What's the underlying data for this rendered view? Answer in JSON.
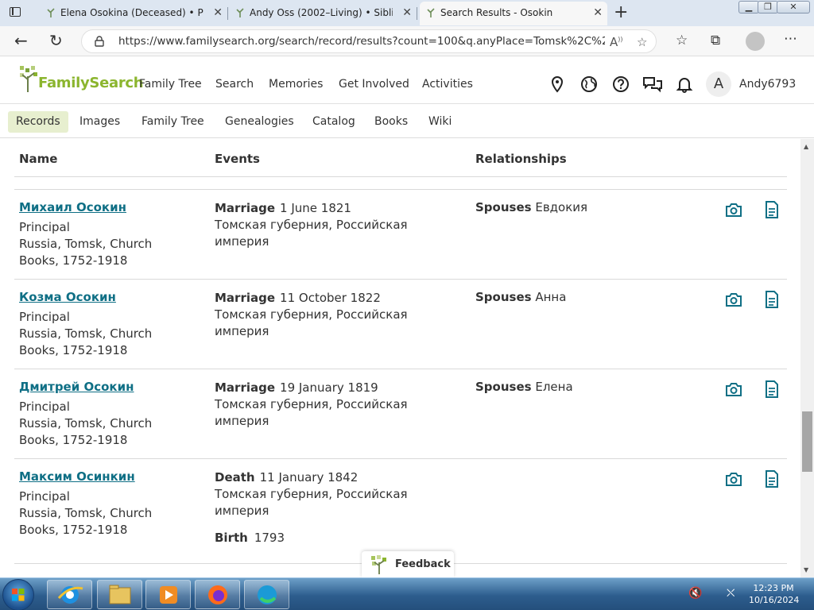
{
  "browser": {
    "tabs": [
      {
        "title": "Elena Osokina (Deceased) • Personal",
        "active": false
      },
      {
        "title": "Andy Oss (2002–Living) • Siblings",
        "active": false
      },
      {
        "title": "Search Results - Osokin",
        "active": true
      }
    ],
    "url": "https://www.familysearch.org/search/record/results?count=100&q.anyPlace=Tomsk%2C%20Rus..."
  },
  "site": {
    "logo_text": "FamilySearch",
    "main_nav": [
      "Family Tree",
      "Search",
      "Memories",
      "Get Involved",
      "Activities"
    ],
    "avatar_initial": "A",
    "username": "Andy6793",
    "sub_nav": [
      "Records",
      "Images",
      "Family Tree",
      "Genealogies",
      "Catalog",
      "Books",
      "Wiki"
    ],
    "active_sub_nav": "Records"
  },
  "results": {
    "columns": {
      "name": "Name",
      "events": "Events",
      "relationships": "Relationships"
    },
    "rows": [
      {
        "name": "Михаил Осокин",
        "role": "Principal",
        "collection": "Russia, Tomsk, Church Books, 1752-1918",
        "event_type": "Marriage",
        "event_date": "1 June 1821",
        "event_place": "Томская губерния, Российская империя",
        "event2_type": "",
        "event2_date": "",
        "rel_label": "Spouses",
        "rel_value": "Евдокия"
      },
      {
        "name": "Козма Осокин",
        "role": "Principal",
        "collection": "Russia, Tomsk, Church Books, 1752-1918",
        "event_type": "Marriage",
        "event_date": "11 October 1822",
        "event_place": "Томская губерния, Российская империя",
        "event2_type": "",
        "event2_date": "",
        "rel_label": "Spouses",
        "rel_value": "Анна"
      },
      {
        "name": "Дмитрей Осокин",
        "role": "Principal",
        "collection": "Russia, Tomsk, Church Books, 1752-1918",
        "event_type": "Marriage",
        "event_date": "19 January 1819",
        "event_place": "Томская губерния, Российская империя",
        "event2_type": "",
        "event2_date": "",
        "rel_label": "Spouses",
        "rel_value": "Елена"
      },
      {
        "name": "Максим Осинкин",
        "role": "Principal",
        "collection": "Russia, Tomsk, Church Books, 1752-1918",
        "event_type": "Death",
        "event_date": "11 January 1842",
        "event_place": "Томская губерния, Российская империя",
        "event2_type": "Birth",
        "event2_date": "1793",
        "rel_label": "",
        "rel_value": ""
      }
    ]
  },
  "feedback_label": "Feedback",
  "taskbar": {
    "time": "12:23 PM",
    "date": "10/16/2024"
  },
  "colors": {
    "link": "#0f6f85",
    "brand_green": "#8bb52e",
    "active_tab_bg": "#e7efcf"
  }
}
